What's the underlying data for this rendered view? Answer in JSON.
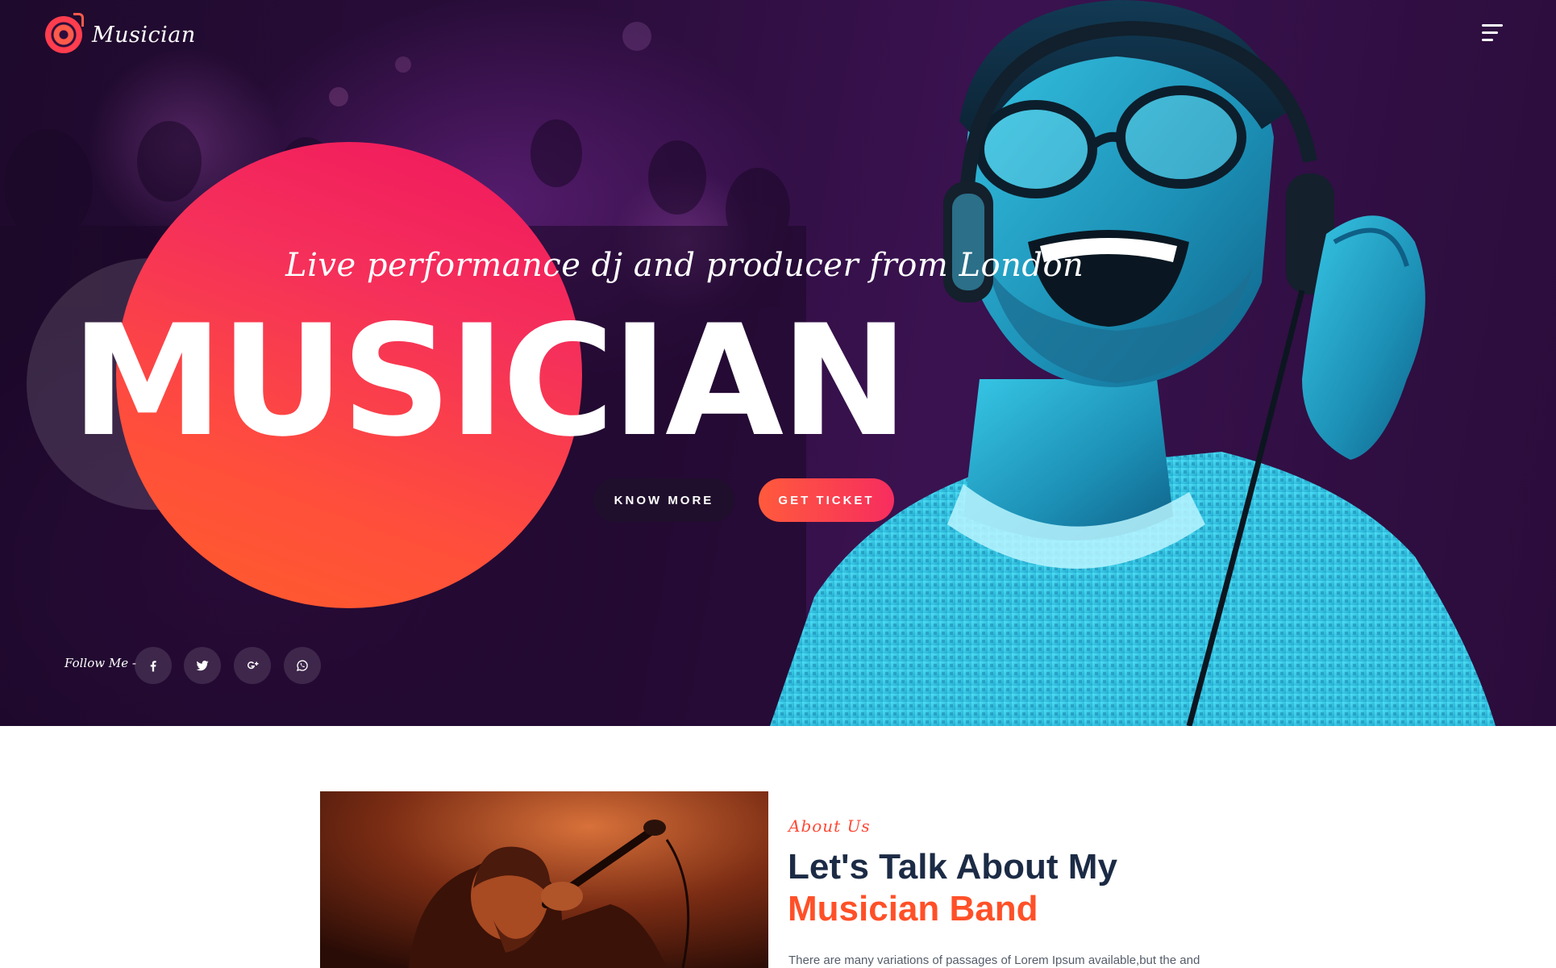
{
  "header": {
    "brand": "Musician",
    "menu_icon": "hamburger-menu-icon"
  },
  "hero": {
    "tagline": "Live performance dj and producer from London",
    "title": "MUSICIAN",
    "know_more_label": "KNOW MORE",
    "get_ticket_label": "GET TICKET",
    "follow_label": "Follow Me -",
    "social": [
      "facebook-icon",
      "twitter-icon",
      "google-plus-icon",
      "whatsapp-icon"
    ]
  },
  "about": {
    "kicker": "About Us",
    "heading_line1": "Let's Talk About My",
    "heading_line2": "Musician Band",
    "paragraph": "There are many variations of passages of Lorem Ipsum available,but the and"
  },
  "colors": {
    "accent": "#ff5028",
    "accent_pink": "#f0165f",
    "hero_bg": "#2b0d3c",
    "heading_dark": "#1c2b45"
  }
}
